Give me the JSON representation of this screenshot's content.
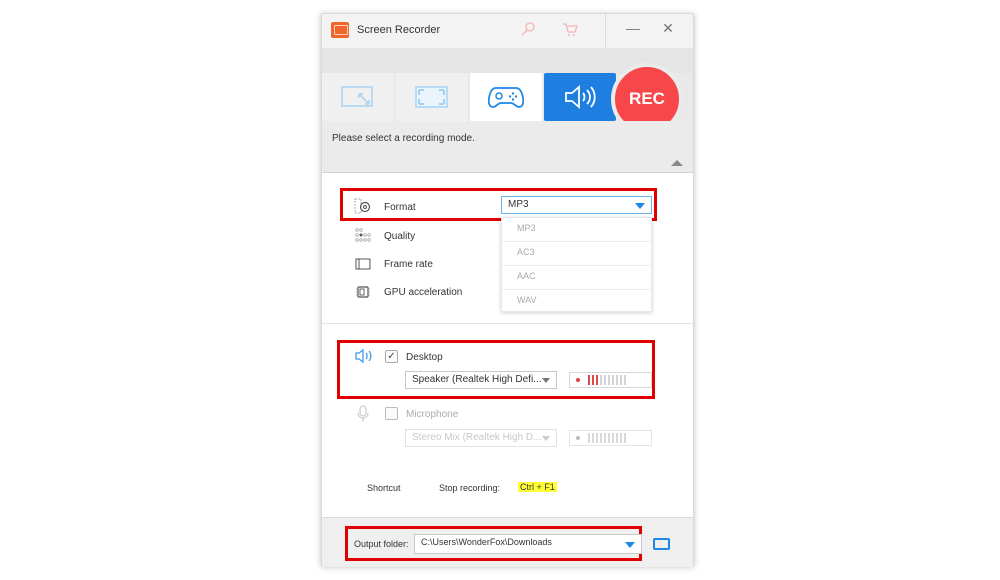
{
  "window": {
    "title": "Screen Recorder",
    "titlebar_icons": [
      "key-icon",
      "cart-icon"
    ],
    "minimize_label": "—",
    "close_label": "✕"
  },
  "modes": [
    {
      "name": "region-mode",
      "icon": "region-icon",
      "state": "normal"
    },
    {
      "name": "fullscreen-mode",
      "icon": "fullscreen-icon",
      "state": "normal"
    },
    {
      "name": "game-mode",
      "icon": "gamepad-icon",
      "state": "hover"
    },
    {
      "name": "audio-mode",
      "icon": "speaker-icon",
      "state": "selected"
    }
  ],
  "rec_label": "REC",
  "hint": "Please select a recording mode.",
  "settings": {
    "format_label": "Format",
    "format_value": "MP3",
    "format_options": [
      "MP3",
      "AC3",
      "AAC",
      "WAV"
    ],
    "quality_label": "Quality",
    "frame_rate_label": "Frame rate",
    "gpu_label": "GPU acceleration"
  },
  "audio": {
    "desktop_label": "Desktop",
    "desktop_checked": true,
    "desktop_device": "Speaker (Realtek High Defi...",
    "desktop_level_bars_active": 3,
    "microphone_label": "Microphone",
    "microphone_checked": false,
    "microphone_device": "Stereo Mix (Realtek High D...",
    "level_bars_total": 10
  },
  "shortcut": {
    "label": "Shortcut",
    "action": "Stop recording:",
    "key": "Ctrl + F1"
  },
  "output": {
    "label": "Output folder:",
    "path": "C:\\Users\\WonderFox\\Downloads"
  },
  "colors": {
    "accent_blue": "#1f7fe0",
    "rec_red": "#f7474a",
    "highlight_red": "#e00000",
    "shortcut_yellow": "#ffff33"
  }
}
